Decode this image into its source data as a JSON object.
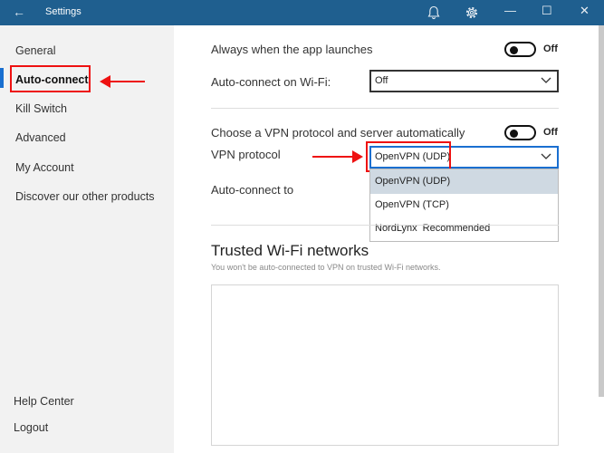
{
  "window": {
    "title": "Settings",
    "back_glyph": "←",
    "minimize_glyph": "—",
    "maximize_glyph": "☐",
    "close_glyph": "✕"
  },
  "sidebar": {
    "items": [
      {
        "label": "General"
      },
      {
        "label": "Auto-connect"
      },
      {
        "label": "Kill Switch"
      },
      {
        "label": "Advanced"
      },
      {
        "label": "My Account"
      },
      {
        "label": "Discover our other products"
      }
    ],
    "help_center": "Help Center",
    "logout": "Logout"
  },
  "settings": {
    "always_launch": {
      "label": "Always when the app launches",
      "state": "Off"
    },
    "autoconnect_wifi": {
      "label": "Auto-connect on Wi-Fi:",
      "value": "Off"
    },
    "auto_protocol": {
      "label": "Choose a VPN protocol and server automatically",
      "state": "Off"
    },
    "vpn_protocol": {
      "label": "VPN protocol",
      "value": "OpenVPN (UDP)",
      "options": [
        {
          "name": "OpenVPN (UDP)",
          "selected": true
        },
        {
          "name": "OpenVPN (TCP)",
          "selected": false
        },
        {
          "name": "NordLynx",
          "tag": "Recommended",
          "selected": false
        }
      ]
    },
    "autoconnect_to": {
      "label": "Auto-connect to"
    }
  },
  "trusted": {
    "title": "Trusted Wi-Fi networks",
    "subtitle": "You won't be auto-connected to VPN on trusted Wi-Fi networks."
  },
  "colors": {
    "titlebar": "#1f5f8f",
    "accent": "#1a6fd0",
    "annotation": "#e11111",
    "selected_option": "#cfd9e2"
  }
}
